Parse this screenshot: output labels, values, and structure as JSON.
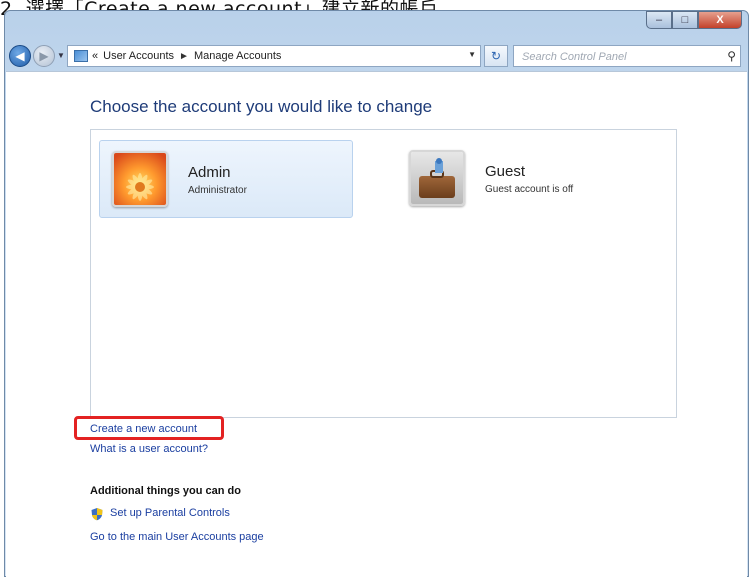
{
  "caption": "2. 選擇「Create a new account」建立新的帳戶。",
  "window": {
    "controls": {
      "minimize": "–",
      "maximize": "□",
      "close": "X"
    }
  },
  "address_bar": {
    "prefix": "«",
    "crumbs": [
      "User Accounts",
      "Manage Accounts"
    ],
    "separator": "►",
    "dropdown_glyph": "▼"
  },
  "search": {
    "placeholder": "Search Control Panel",
    "value": ""
  },
  "main": {
    "heading": "Choose the account you would like to change",
    "accounts": [
      {
        "name": "Admin",
        "role": "Administrator"
      },
      {
        "name": "Guest",
        "role": "Guest account is off"
      }
    ],
    "links": {
      "create_account": "Create a new account",
      "what_is": "What is a user account?"
    },
    "additional_title": "Additional things you can do",
    "additional_links": {
      "parental": "Set up Parental Controls",
      "main_page": "Go to the main User Accounts page"
    }
  },
  "colors": {
    "link": "#1a3ea0",
    "heading": "#1e3b78",
    "highlight": "#e32222",
    "selected_tile": "#dbe9f8"
  }
}
